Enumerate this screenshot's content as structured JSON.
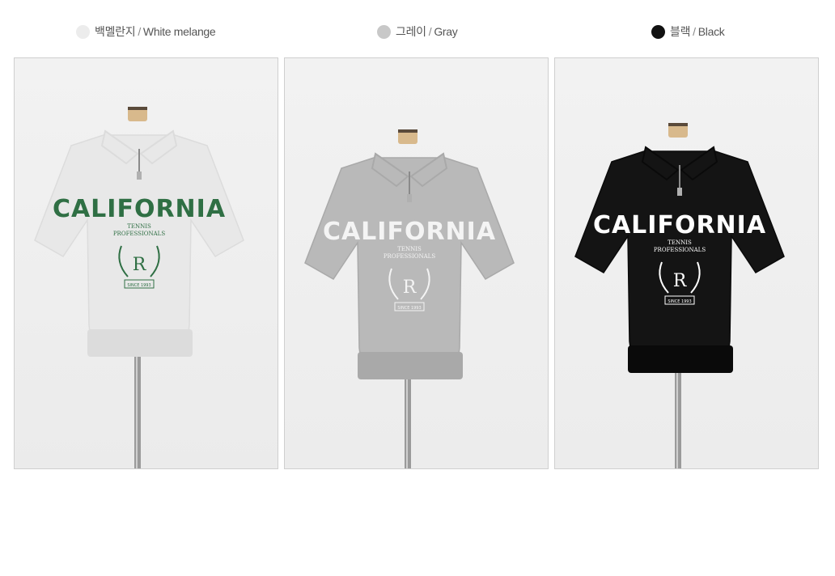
{
  "colors_row": [
    {
      "ko": "백멜란지",
      "sep": "/",
      "en": "White melange",
      "dot": "#ececec"
    },
    {
      "ko": "그레이",
      "sep": "/",
      "en": "Gray",
      "dot": "#c8c8c8"
    },
    {
      "ko": "블랙",
      "sep": "/",
      "en": "Black",
      "dot": "#111111"
    }
  ],
  "products": [
    {
      "name": "white-melange-shirt",
      "shirt_color": "#e8e8e8",
      "shirt_shade": "#dcdcdc",
      "print_color": "#2f6f44",
      "bg_color": "#ebebeb",
      "print": {
        "main": "CALIFORNIA",
        "sub1": "TENNIS",
        "sub2": "PROFESSIONALS",
        "letter": "R",
        "since": "SINCE 1993"
      }
    },
    {
      "name": "gray-shirt",
      "shirt_color": "#b9b9b9",
      "shirt_shade": "#a9a9a9",
      "print_color": "#f4f4f4",
      "bg_color": "#ececec",
      "print": {
        "main": "CALIFORNIA",
        "sub1": "TENNIS",
        "sub2": "PROFESSIONALS",
        "letter": "R",
        "since": "SINCE 1993"
      }
    },
    {
      "name": "black-shirt",
      "shirt_color": "#141414",
      "shirt_shade": "#0a0a0a",
      "print_color": "#ffffff",
      "bg_color": "#ececec",
      "print": {
        "main": "CALIFORNIA",
        "sub1": "TENNIS",
        "sub2": "PROFESSIONALS",
        "letter": "R",
        "since": "SINCE 1993"
      }
    }
  ]
}
